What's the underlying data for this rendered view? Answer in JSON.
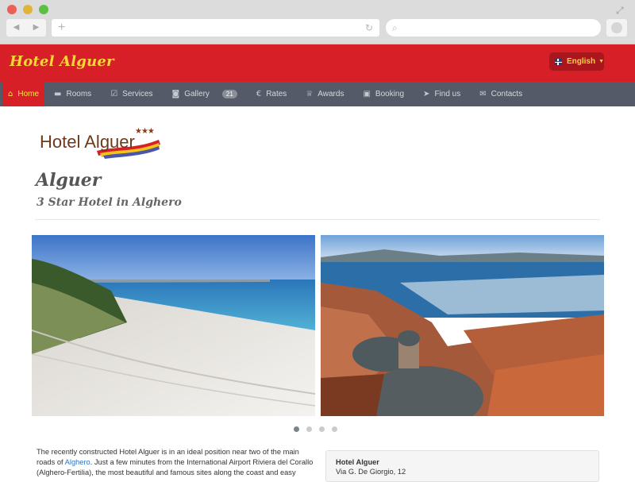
{
  "header": {
    "brand": "Hotel Alguer",
    "language": "English"
  },
  "menu": [
    {
      "label": "Home",
      "icon": "home-icon",
      "glyph": "⌂",
      "active": true
    },
    {
      "label": "Rooms",
      "icon": "bed-icon",
      "glyph": "▬"
    },
    {
      "label": "Services",
      "icon": "check-square-icon",
      "glyph": "☑"
    },
    {
      "label": "Gallery",
      "icon": "camera-icon",
      "glyph": "◙",
      "badge": "21"
    },
    {
      "label": "Rates",
      "icon": "euro-icon",
      "glyph": "€"
    },
    {
      "label": "Awards",
      "icon": "trophy-icon",
      "glyph": "♕"
    },
    {
      "label": "Booking",
      "icon": "calendar-icon",
      "glyph": "▣"
    },
    {
      "label": "Find us",
      "icon": "location-arrow-icon",
      "glyph": "➤"
    },
    {
      "label": "Contacts",
      "icon": "envelope-icon",
      "glyph": "✉"
    }
  ],
  "logo": {
    "text": "Hotel Alguer",
    "stars": "★★★"
  },
  "page": {
    "title": "Alguer",
    "subtitle": "3 Star Hotel in Alghero"
  },
  "slider": {
    "dots": 4,
    "active": 0
  },
  "intro": {
    "line1": "The recently constructed Hotel Alguer is in an ideal position near two of the main",
    "line2_pre": "roads of ",
    "link": "Alghero",
    "line2_post": ". Just a few minutes from the International Airport Riviera del Corallo",
    "line3": "(Alghero-Fertilia), the most beautiful and famous sites along the coast and easy"
  },
  "info": {
    "name": "Hotel Alguer",
    "address": "Via G. De Giorgio, 12"
  },
  "colors": {
    "header_red": "#d61f26",
    "brand_yellow": "#f8d63a",
    "menu_bg": "#545a67"
  }
}
